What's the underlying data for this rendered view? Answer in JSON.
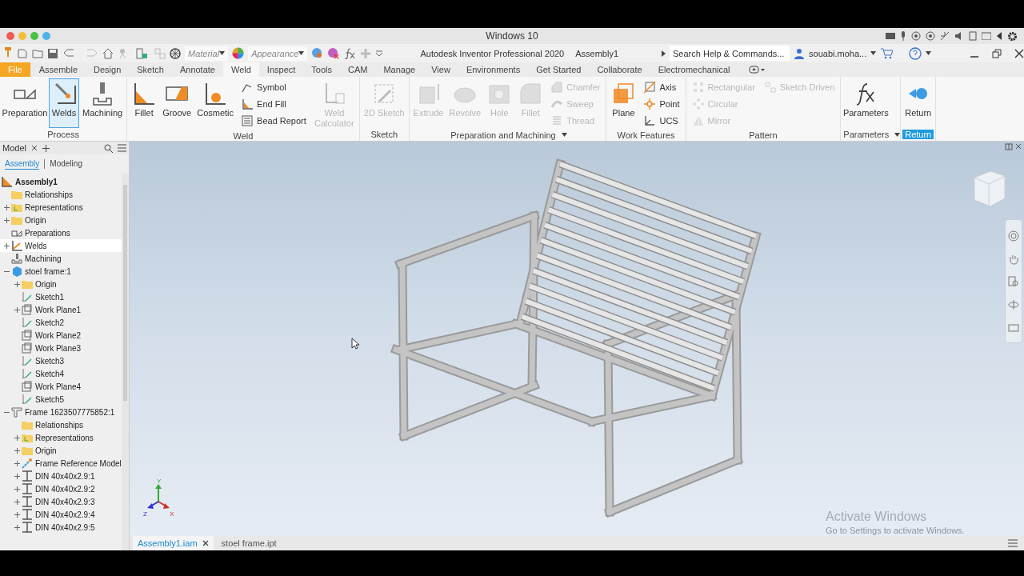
{
  "os_bar": {
    "title": "Windows 10"
  },
  "quick_access": {
    "material": "Material",
    "appearance": "Appearance",
    "app_title": "Autodesk Inventor Professional 2020",
    "document": "Assembly1",
    "search": {
      "placeholder": "Search Help & Commands..."
    },
    "user": "souabi.moha..."
  },
  "ribbon_tabs": [
    {
      "label": "File",
      "kind": "file",
      "selected": false
    },
    {
      "label": "Assemble",
      "kind": "tab",
      "selected": false
    },
    {
      "label": "Design",
      "kind": "tab",
      "selected": false
    },
    {
      "label": "Sketch",
      "kind": "tab",
      "selected": false
    },
    {
      "label": "Annotate",
      "kind": "tab",
      "selected": false
    },
    {
      "label": "Weld",
      "kind": "tab",
      "selected": true
    },
    {
      "label": "Inspect",
      "kind": "tab",
      "selected": false
    },
    {
      "label": "Tools",
      "kind": "tab",
      "selected": false
    },
    {
      "label": "CAM",
      "kind": "tab",
      "selected": false
    },
    {
      "label": "Manage",
      "kind": "tab",
      "selected": false
    },
    {
      "label": "View",
      "kind": "tab",
      "selected": false
    },
    {
      "label": "Environments",
      "kind": "tab",
      "selected": false
    },
    {
      "label": "Get Started",
      "kind": "tab",
      "selected": false
    },
    {
      "label": "Collaborate",
      "kind": "tab",
      "selected": false
    },
    {
      "label": "Electromechanical",
      "kind": "tab",
      "selected": false
    }
  ],
  "ribbon_panels": [
    {
      "title": "Process",
      "dropdown": false,
      "highlighted": false,
      "tools": [
        {
          "label": "Preparation",
          "kind": "large",
          "selected": false,
          "disabled": false
        },
        {
          "label": "Welds",
          "kind": "large",
          "selected": true,
          "disabled": false
        },
        {
          "label": "Machining",
          "kind": "large",
          "selected": false,
          "disabled": false
        }
      ]
    },
    {
      "title": "Weld",
      "dropdown": false,
      "highlighted": false,
      "tools": [
        {
          "label": "Fillet",
          "kind": "large",
          "selected": false,
          "disabled": false
        },
        {
          "label": "Groove",
          "kind": "large",
          "selected": false,
          "disabled": false
        },
        {
          "label": "Cosmetic",
          "kind": "large",
          "selected": false,
          "disabled": false
        },
        {
          "label": "Symbol",
          "kind": "small",
          "selected": false,
          "disabled": false
        },
        {
          "label": "End Fill",
          "kind": "small",
          "selected": false,
          "disabled": false
        },
        {
          "label": "Bead Report",
          "kind": "small",
          "selected": false,
          "disabled": false
        },
        {
          "label": "Weld Calculator",
          "kind": "large",
          "selected": false,
          "disabled": true
        }
      ]
    },
    {
      "title": "Sketch",
      "dropdown": false,
      "highlighted": false,
      "tools": [
        {
          "label": "2D Sketch",
          "kind": "large",
          "selected": false,
          "disabled": true
        }
      ]
    },
    {
      "title": "Preparation and Machining",
      "dropdown": true,
      "highlighted": false,
      "tools": [
        {
          "label": "Extrude",
          "kind": "large",
          "selected": false,
          "disabled": true
        },
        {
          "label": "Revolve",
          "kind": "large",
          "selected": false,
          "disabled": true
        },
        {
          "label": "Hole",
          "kind": "large",
          "selected": false,
          "disabled": true
        },
        {
          "label": "Fillet",
          "kind": "large",
          "selected": false,
          "disabled": true
        },
        {
          "label": "Chamfer",
          "kind": "small",
          "selected": false,
          "disabled": true
        },
        {
          "label": "Sweep",
          "kind": "small",
          "selected": false,
          "disabled": true
        },
        {
          "label": "Thread",
          "kind": "small",
          "selected": false,
          "disabled": true
        }
      ]
    },
    {
      "title": "Work Features",
      "dropdown": false,
      "highlighted": false,
      "tools": [
        {
          "label": "Plane",
          "kind": "large",
          "selected": false,
          "disabled": false
        },
        {
          "label": "Axis",
          "kind": "small",
          "selected": false,
          "disabled": false
        },
        {
          "label": "Point",
          "kind": "small",
          "selected": false,
          "disabled": false
        },
        {
          "label": "UCS",
          "kind": "small",
          "selected": false,
          "disabled": false
        }
      ]
    },
    {
      "title": "Pattern",
      "dropdown": false,
      "highlighted": false,
      "tools": [
        {
          "label": "Rectangular",
          "kind": "small",
          "selected": false,
          "disabled": true
        },
        {
          "label": "Circular",
          "kind": "small",
          "selected": false,
          "disabled": true
        },
        {
          "label": "Mirror",
          "kind": "small",
          "selected": false,
          "disabled": true
        },
        {
          "label": "Sketch Driven",
          "kind": "small",
          "selected": false,
          "disabled": true
        }
      ]
    },
    {
      "title": "Parameters",
      "dropdown": true,
      "highlighted": false,
      "tools": [
        {
          "label": "Parameters",
          "kind": "large",
          "selected": false,
          "disabled": false
        }
      ]
    },
    {
      "title": "Return",
      "dropdown": false,
      "highlighted": true,
      "tools": [
        {
          "label": "Return",
          "kind": "large",
          "selected": false,
          "disabled": false
        }
      ]
    }
  ],
  "model_panel": {
    "title": "Model",
    "subtabs": [
      {
        "label": "Assembly",
        "selected": true
      },
      {
        "label": "Modeling",
        "selected": false
      }
    ],
    "tree": [
      {
        "label": "Assembly1",
        "kind": "assembly",
        "selected": false,
        "children": [
          {
            "label": "Relationships",
            "kind": "folder",
            "selected": false
          },
          {
            "label": "Representations",
            "kind": "representations",
            "selected": false,
            "expanded": false
          },
          {
            "label": "Origin",
            "kind": "folder",
            "selected": false,
            "expanded": false
          },
          {
            "label": "Preparations",
            "kind": "preparations",
            "selected": false
          },
          {
            "label": "Welds",
            "kind": "welds",
            "selected": true,
            "expanded": false
          },
          {
            "label": "Machining",
            "kind": "machining",
            "selected": false
          },
          {
            "label": "stoel frame:1",
            "kind": "part",
            "selected": false,
            "expanded": true,
            "children": [
              {
                "label": "Origin",
                "kind": "folder",
                "selected": false,
                "expanded": false
              },
              {
                "label": "Sketch1",
                "kind": "sketch",
                "selected": false
              },
              {
                "label": "Work Plane1",
                "kind": "workplane",
                "selected": false,
                "expanded": false
              },
              {
                "label": "Sketch2",
                "kind": "sketch",
                "selected": false
              },
              {
                "label": "Work Plane2",
                "kind": "workplane",
                "selected": false
              },
              {
                "label": "Work Plane3",
                "kind": "workplane",
                "selected": false
              },
              {
                "label": "Sketch3",
                "kind": "sketch",
                "selected": false
              },
              {
                "label": "Sketch4",
                "kind": "sketch",
                "selected": false
              },
              {
                "label": "Work Plane4",
                "kind": "workplane",
                "selected": false
              },
              {
                "label": "Sketch5",
                "kind": "sketch",
                "selected": false
              }
            ]
          },
          {
            "label": "Frame 1623507775852:1",
            "kind": "frame",
            "selected": false,
            "expanded": true,
            "children": [
              {
                "label": "Relationships",
                "kind": "folder",
                "selected": false
              },
              {
                "label": "Representations",
                "kind": "representations",
                "selected": false,
                "expanded": false
              },
              {
                "label": "Origin",
                "kind": "folder",
                "selected": false,
                "expanded": false
              },
              {
                "label": "Frame Reference Model",
                "kind": "framemodel",
                "selected": false,
                "expanded": false
              },
              {
                "label": "DIN 40x40x2.9:1",
                "kind": "profile",
                "selected": false,
                "expanded": false
              },
              {
                "label": "DIN 40x40x2.9:2",
                "kind": "profile",
                "selected": false,
                "expanded": false
              },
              {
                "label": "DIN 40x40x2.9:3",
                "kind": "profile",
                "selected": false,
                "expanded": false
              },
              {
                "label": "DIN 40x40x2.9:4",
                "kind": "profile",
                "selected": false,
                "expanded": false
              },
              {
                "label": "DIN 40x40x2.9:5",
                "kind": "profile",
                "selected": false,
                "expanded": false
              }
            ]
          }
        ]
      }
    ]
  },
  "viewport": {
    "axes": [
      "Y",
      "Z",
      "X"
    ],
    "activation_notice": {
      "title": "Activate Windows",
      "subtitle": "Go to Settings to activate Windows."
    }
  },
  "document_tabs": [
    {
      "label": "Assembly1.iam",
      "selected": true,
      "closable": true
    },
    {
      "label": "stoel frame.ipt",
      "selected": false,
      "closable": false
    }
  ]
}
